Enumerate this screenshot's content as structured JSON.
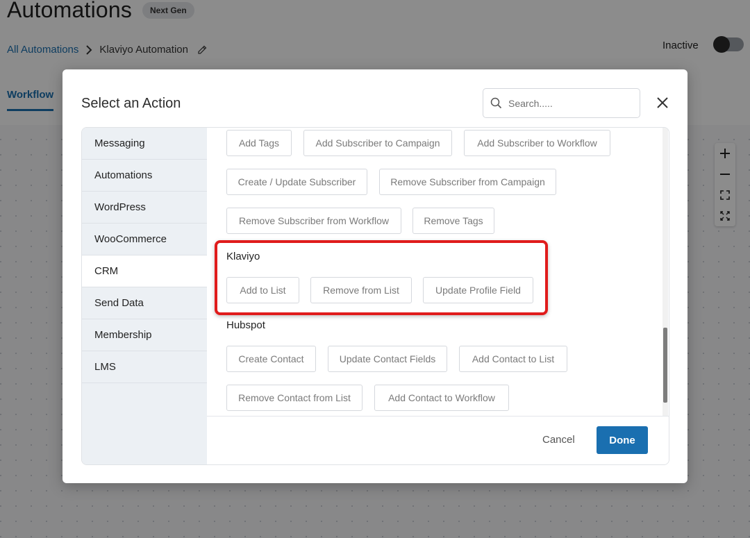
{
  "header": {
    "title": "Automations",
    "badge": "Next Gen",
    "breadcrumb": {
      "parent": "All Automations",
      "current": "Klaviyo Automation"
    },
    "status_label": "Inactive",
    "tab": "Workflow",
    "zoom_controls": [
      "plus-icon",
      "minus-icon",
      "fit-screen-icon",
      "fullscreen-icon"
    ]
  },
  "modal": {
    "title": "Select an Action",
    "search_placeholder": "Search.....",
    "categories": [
      "Messaging",
      "Automations",
      "WordPress",
      "WooCommerce",
      "CRM",
      "Send Data",
      "Membership",
      "LMS"
    ],
    "active_category": "CRM",
    "top_actions": {
      "row1": [
        "Add Tags",
        "Add Subscriber to Campaign",
        "Add Subscriber to Workflow"
      ],
      "row2": [
        "Create / Update Subscriber",
        "Remove Subscriber from Campaign"
      ],
      "row3": [
        "Remove Subscriber from Workflow",
        "Remove Tags"
      ]
    },
    "klaviyo": {
      "label": "Klaviyo",
      "actions": [
        "Add to List",
        "Remove from List",
        "Update Profile Field"
      ]
    },
    "hubspot": {
      "label": "Hubspot",
      "row1": [
        "Create Contact",
        "Update Contact Fields",
        "Add Contact to List"
      ],
      "row2": [
        "Remove Contact from List",
        "Add Contact to Workflow"
      ]
    },
    "footer": {
      "cancel": "Cancel",
      "done": "Done"
    }
  },
  "colors": {
    "accent": "#1a6fb0",
    "highlight": "#e01c1c",
    "sidebar_bg": "#ecf0f4"
  }
}
